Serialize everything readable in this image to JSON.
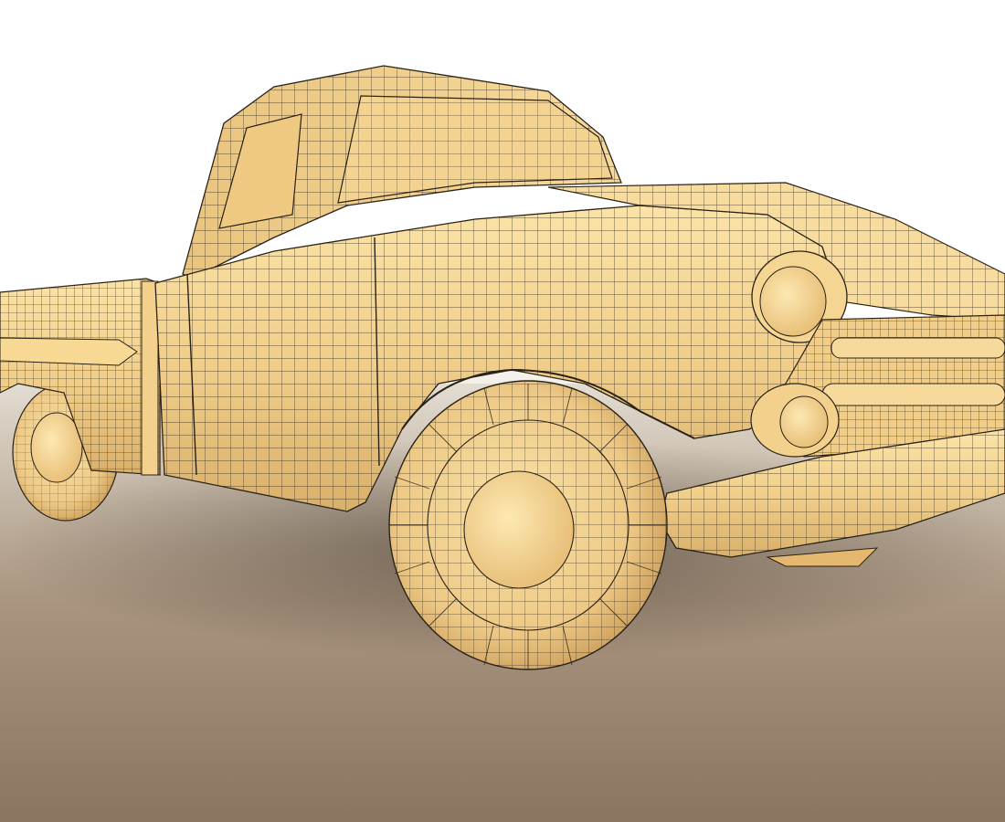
{
  "scene": {
    "subject": "pickup-truck-wireframe-render",
    "colors": {
      "body": "#f3d18c",
      "body_light": "#fbe3a6",
      "body_shadow": "#d6ab62",
      "wire": "#2a2216",
      "floor_near": "#8a7560",
      "floor_far": "#d2cabd",
      "sky": "#ffffff"
    }
  }
}
